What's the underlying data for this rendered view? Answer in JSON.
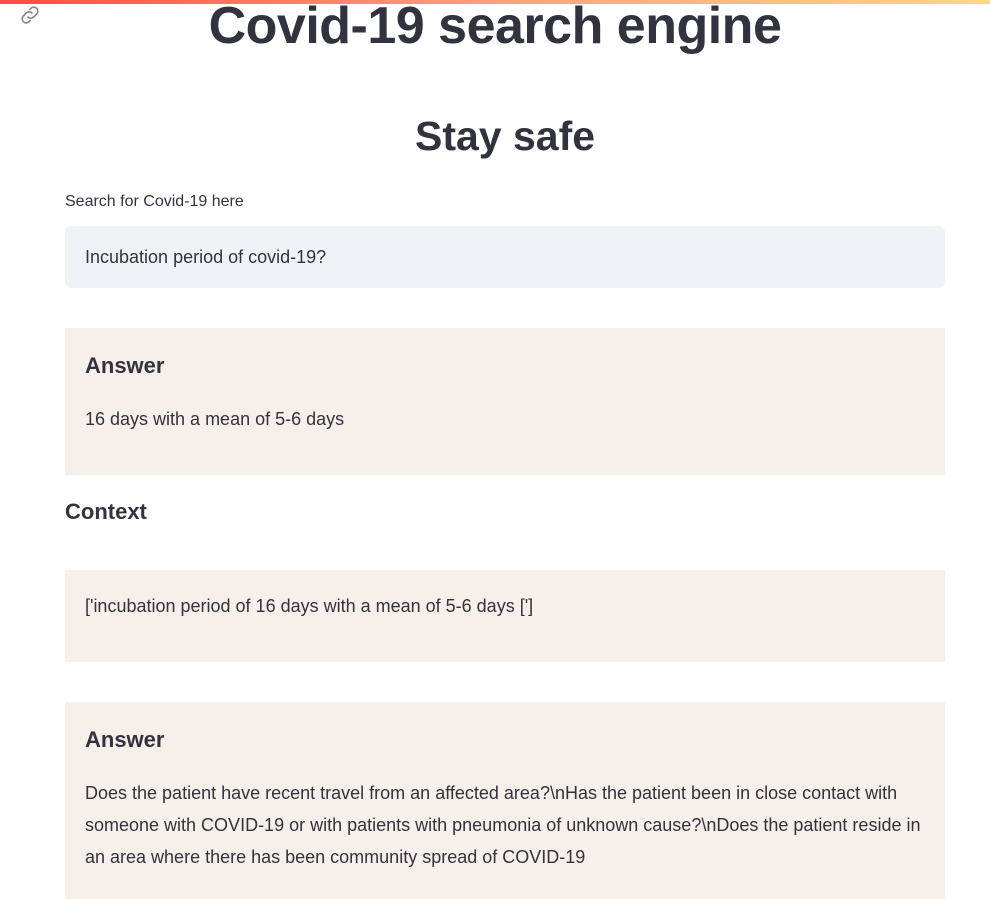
{
  "app": {
    "title": "Covid-19 search engine",
    "subtitle": "Stay safe"
  },
  "search": {
    "label": "Search for Covid-19 here",
    "value": "Incubation period of covid-19?"
  },
  "results": [
    {
      "answer_heading": "Answer",
      "answer_text": "16 days with a mean of 5-6 days",
      "context_heading": "Context",
      "context_text": "['incubation period of 16 days with a mean of 5-6 days [']"
    },
    {
      "answer_heading": "Answer",
      "answer_text": "Does the patient have recent travel from an affected area?\\nHas the patient been in close contact with someone with COVID-19 or with patients with pneumonia of unknown cause?\\nDoes the patient reside in an area where there has been community spread of COVID-19"
    }
  ],
  "colors": {
    "text": "#31333f",
    "input_bg": "#f0f2f6",
    "card_bg": "#f7efe9",
    "accent_gradient_start": "#ff4b4b",
    "accent_gradient_end": "#fdd882"
  },
  "icons": {
    "anchor_link": "link-icon"
  }
}
